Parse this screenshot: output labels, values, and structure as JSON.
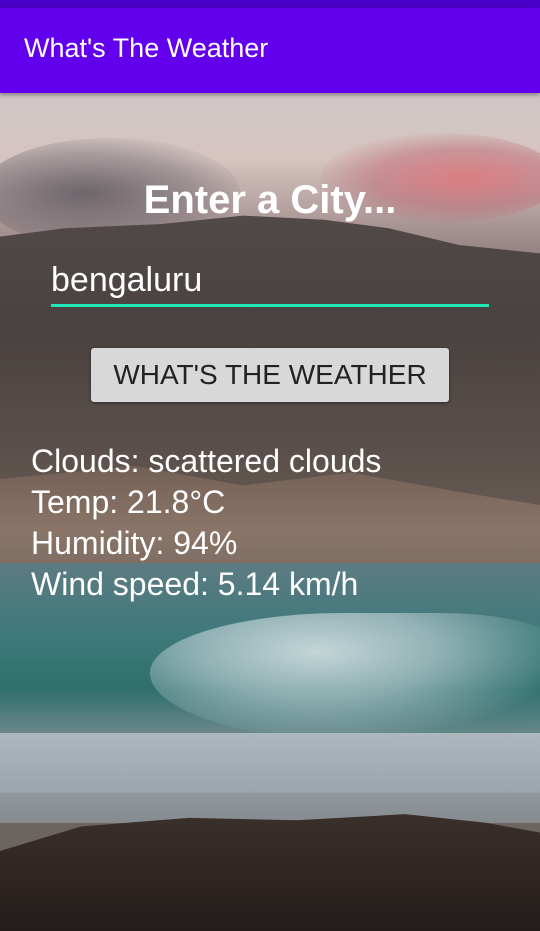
{
  "app_bar": {
    "title": "What's The Weather"
  },
  "main": {
    "heading": "Enter a City...",
    "city_input": {
      "value": "bengaluru"
    },
    "button_label": "WHAT'S THE WEATHER",
    "result": {
      "clouds": "Clouds: scattered clouds",
      "temp": "Temp: 21.8°C",
      "humidity": "Humidity: 94%",
      "wind": "Wind speed: 5.14 km/h"
    }
  },
  "colors": {
    "app_bar": "#6200ee",
    "input_underline": "#1de9b6",
    "button_background": "#d8d8d8"
  }
}
